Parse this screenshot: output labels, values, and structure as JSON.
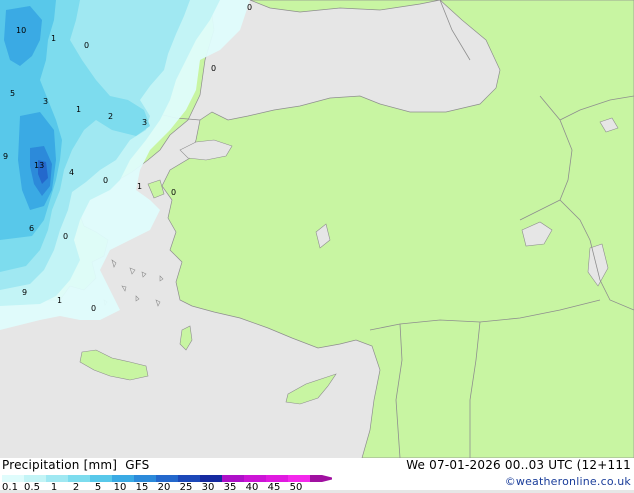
{
  "legend": {
    "title": "Precipitation [mm]",
    "model": "GFS",
    "ticks": [
      "0.1",
      "0.5",
      "1",
      "2",
      "5",
      "10",
      "15",
      "20",
      "25",
      "30",
      "35",
      "40",
      "45",
      "50"
    ],
    "colors": [
      "#dffcfc",
      "#c3f4f6",
      "#a0e8f2",
      "#7ddcee",
      "#58c8ea",
      "#3aaae4",
      "#2c8ada",
      "#2468cc",
      "#1c48b8",
      "#152aa0",
      "#ae10c8",
      "#cc14d6",
      "#e01ae0",
      "#f428ec",
      "#a010a0"
    ]
  },
  "timestamp": "We 07-01-2026 00..03 UTC (12+111",
  "credit": "©weatheronline.co.uk",
  "colors": {
    "land": "#c8f5a2",
    "sea": "#e6e6e6",
    "border": "#8e8e8e"
  },
  "map_values": [
    {
      "id": "v1",
      "text": "10"
    },
    {
      "id": "v2",
      "text": "1"
    },
    {
      "id": "v3",
      "text": "0"
    },
    {
      "id": "v4",
      "text": "0"
    },
    {
      "id": "v5",
      "text": "0"
    },
    {
      "id": "v6",
      "text": "5"
    },
    {
      "id": "v7",
      "text": "3"
    },
    {
      "id": "v8",
      "text": "1"
    },
    {
      "id": "v9",
      "text": "2"
    },
    {
      "id": "v10",
      "text": "3"
    },
    {
      "id": "v11",
      "text": "9"
    },
    {
      "id": "v12",
      "text": "13"
    },
    {
      "id": "v13",
      "text": "4"
    },
    {
      "id": "v14",
      "text": "0"
    },
    {
      "id": "v15",
      "text": "1"
    },
    {
      "id": "v16",
      "text": "0"
    },
    {
      "id": "v17",
      "text": "6"
    },
    {
      "id": "v18",
      "text": "0"
    },
    {
      "id": "v19",
      "text": "9"
    },
    {
      "id": "v20",
      "text": "1"
    },
    {
      "id": "v21",
      "text": "0"
    }
  ]
}
